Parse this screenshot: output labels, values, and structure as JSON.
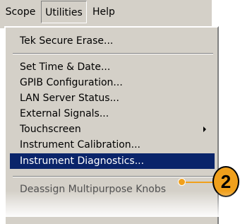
{
  "menubar": {
    "tabs": [
      {
        "label": "Scope"
      },
      {
        "label": "Utilities"
      },
      {
        "label": "Help"
      }
    ]
  },
  "menu": {
    "items": [
      {
        "label": "Tek Secure Erase..."
      },
      {
        "label": "Set Time & Date..."
      },
      {
        "label": "GPIB Configuration..."
      },
      {
        "label": "LAN Server Status..."
      },
      {
        "label": "External Signals..."
      },
      {
        "label": "Touchscreen"
      },
      {
        "label": "Instrument Calibration..."
      },
      {
        "label": "Instrument Diagnostics..."
      },
      {
        "label": "Deassign Multipurpose Knobs"
      }
    ]
  },
  "callout": {
    "number": "2",
    "color": "#f0a01c"
  },
  "icons": {
    "submenu_arrow": "chevron-right-icon"
  },
  "colors": {
    "menu_background": "#d4d0c8",
    "highlight": "#0a246a"
  }
}
